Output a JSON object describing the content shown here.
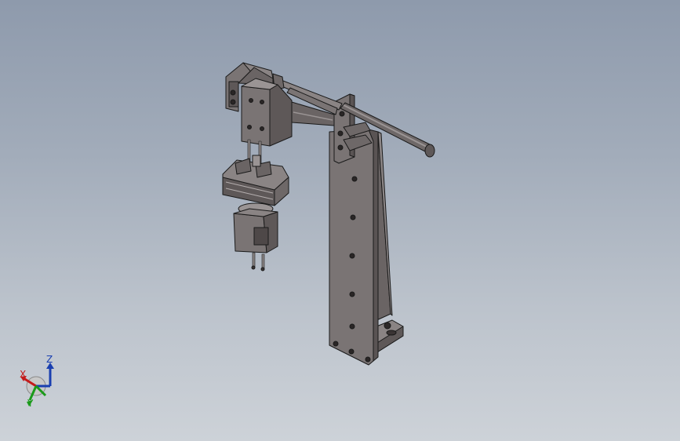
{
  "viewport": {
    "background_top": "#8e9aac",
    "background_bottom": "#cdd2d8",
    "part_color": "#6e6868",
    "edge_color": "#1a1a1a"
  },
  "model": {
    "components": [
      "column",
      "base-foot",
      "gusset",
      "guide-rod",
      "rod-end-cap",
      "rail-bracket",
      "top-mount-block",
      "cylinder-block",
      "gripper-body",
      "gripper-jaws",
      "rotary-actuator",
      "connector-pins"
    ]
  },
  "triad": {
    "x_label": "X",
    "y_label": "Y",
    "z_label": "Z",
    "x_color": "#c41b1b",
    "y_color": "#1a9a1a",
    "z_color": "#1a3fb0"
  }
}
